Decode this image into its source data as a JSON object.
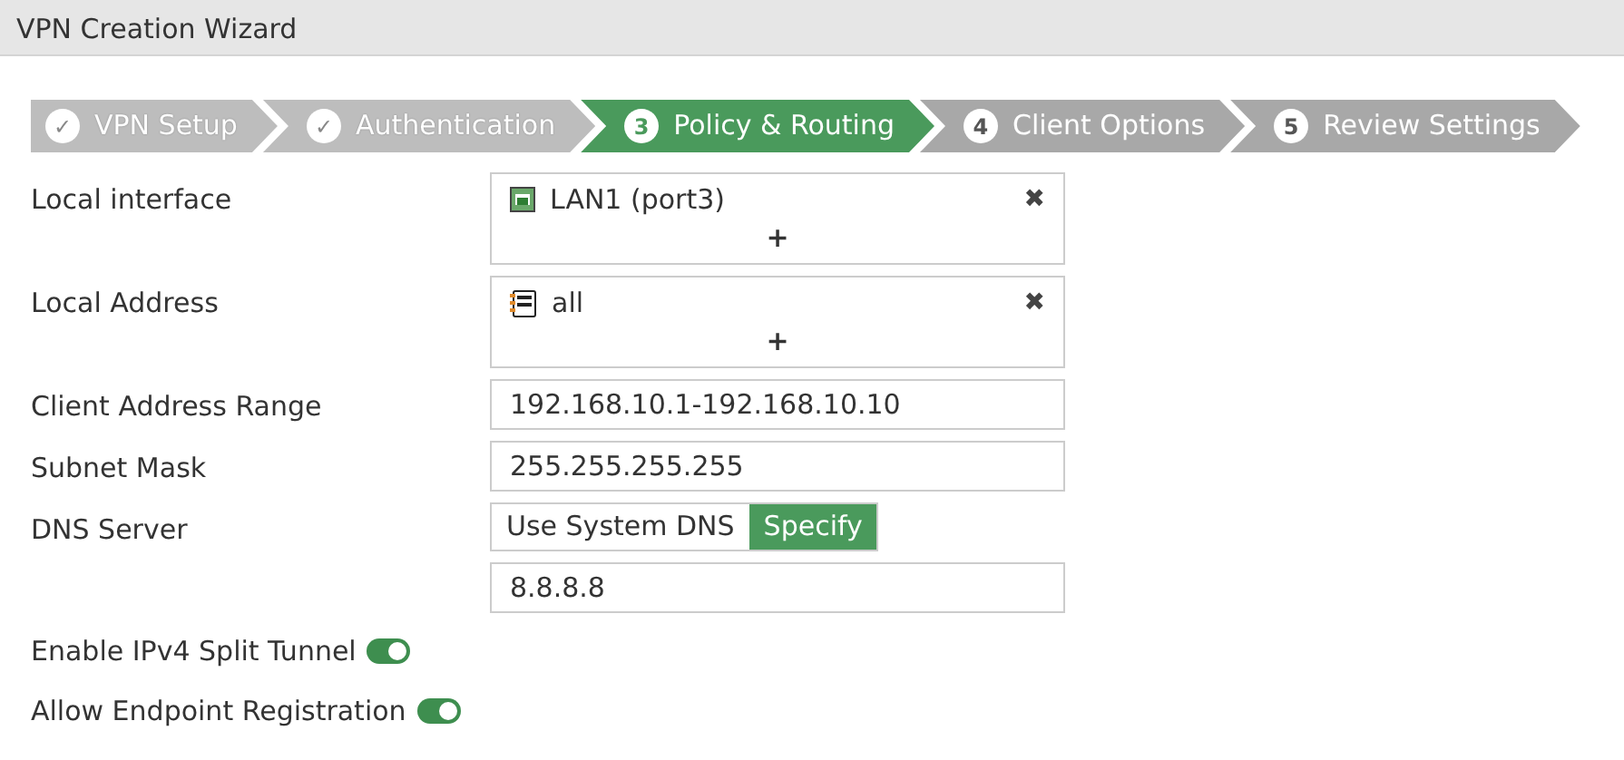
{
  "window": {
    "title": "VPN Creation Wizard"
  },
  "steps": [
    {
      "number": "✓",
      "label": "VPN Setup",
      "done": true,
      "selected": false
    },
    {
      "number": "✓",
      "label": "Authentication",
      "done": true,
      "selected": false
    },
    {
      "number": "3",
      "label": "Policy & Routing",
      "done": false,
      "selected": true
    },
    {
      "number": "4",
      "label": "Client Options",
      "done": false,
      "selected": false
    },
    {
      "number": "5",
      "label": "Review Settings",
      "done": false,
      "selected": false
    }
  ],
  "fields": [
    {
      "kind": "multiselect",
      "label": "Local interface",
      "entries": [
        {
          "kind": "interface",
          "text": "LAN1 (port3)",
          "remove": "✖"
        }
      ],
      "add": "+"
    },
    {
      "kind": "multiselect",
      "label": "Local Address",
      "entries": [
        {
          "kind": "address",
          "text": "all",
          "remove": "✖"
        }
      ],
      "add": "+"
    },
    {
      "kind": "text",
      "label": "Client Address Range",
      "value": "192.168.10.1-192.168.10.10"
    },
    {
      "kind": "text",
      "label": "Subnet Mask",
      "value": "255.255.255.255"
    },
    {
      "kind": "segmented",
      "label": "DNS Server",
      "options": [
        {
          "label": "Use System DNS",
          "selected": false
        },
        {
          "label": "Specify",
          "selected": true
        }
      ]
    },
    {
      "kind": "text",
      "value": "8.8.8.8"
    },
    {
      "kind": "toggle",
      "label": "Enable IPv4 Split Tunnel",
      "on": true
    },
    {
      "kind": "toggle",
      "label": "Allow Endpoint Registration",
      "on": true
    }
  ]
}
